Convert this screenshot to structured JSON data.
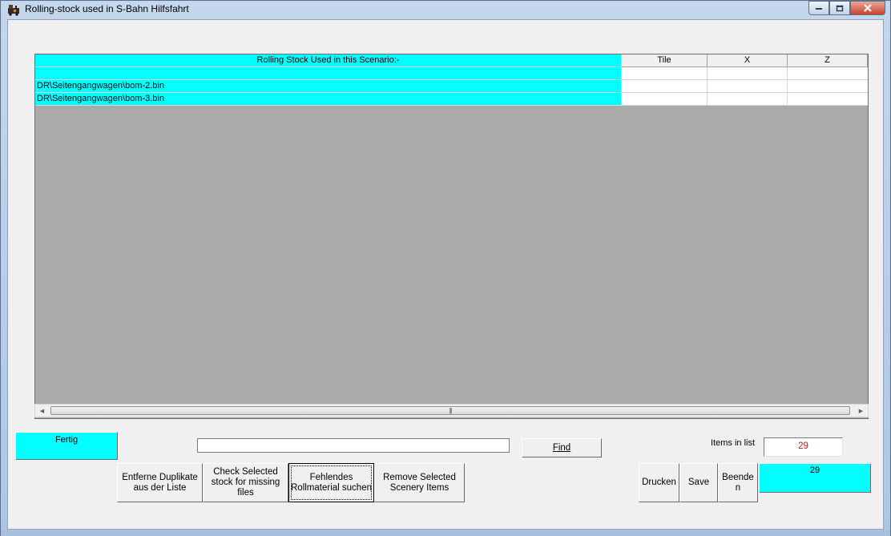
{
  "window": {
    "title": "Rolling-stock used in S-Bahn Hilfsfahrt"
  },
  "colors": {
    "accent": "#00ffff",
    "count_text": "#d01010",
    "grid_background": "#aaaaaa"
  },
  "grid": {
    "columns": [
      "Rolling Stock Used in this Scenario:-",
      "Tile",
      "X",
      "Z"
    ],
    "rows": [
      {
        "name": "",
        "tile": "",
        "x": "",
        "z": ""
      },
      {
        "name": "DR\\Seitengangwagen\\bom-2.bin",
        "tile": "",
        "x": "",
        "z": ""
      },
      {
        "name": "DR\\Seitengangwagen\\bom-3.bin",
        "tile": "",
        "x": "",
        "z": ""
      }
    ]
  },
  "status": {
    "text": "Fertig"
  },
  "search": {
    "value": "",
    "find_label": "Find"
  },
  "items": {
    "label": "Items in list",
    "count": "29"
  },
  "buttons": {
    "remove_duplicates": [
      "Entferne Duplikate",
      "aus der Liste"
    ],
    "check_selected": [
      "Check Selected",
      "stock for missing files"
    ],
    "find_missing": [
      "Fehlendes",
      "Rollmaterial suchen"
    ],
    "remove_selected": [
      "Remove Selected",
      "Scenery Items"
    ],
    "print": "Drucken",
    "save": "Save",
    "exit": [
      "Beende",
      "n"
    ]
  },
  "summary": {
    "count": "29"
  }
}
